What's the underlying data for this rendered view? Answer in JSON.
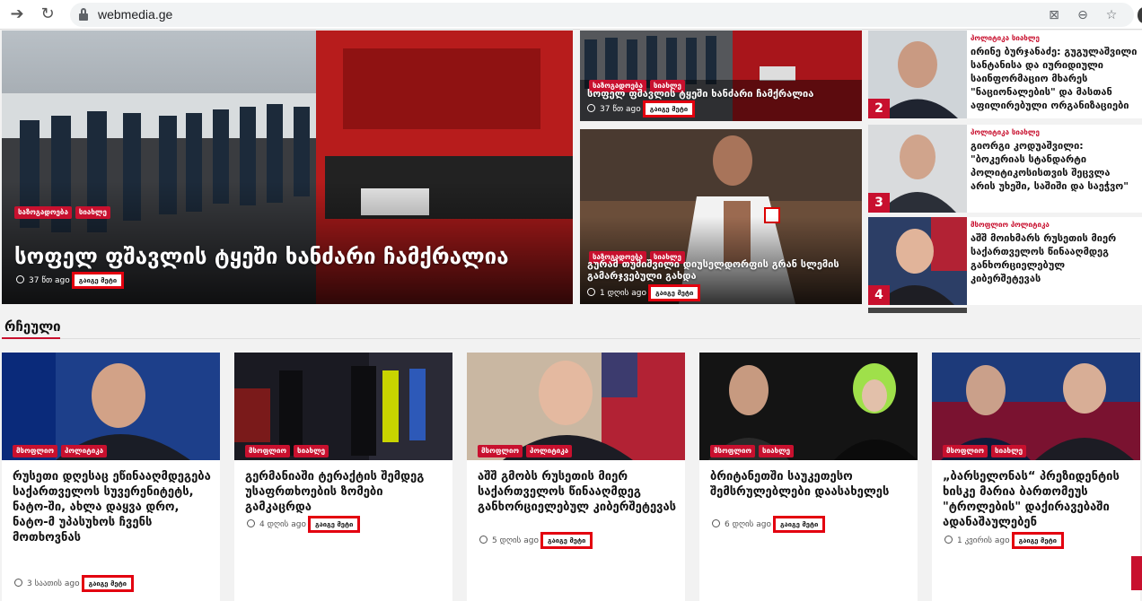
{
  "browser": {
    "url": "webmedia.ge"
  },
  "hero": {
    "tags": [
      "საზოგადოება",
      "სიახლე"
    ],
    "title": "სოფელ ფშავლის ტყეში ხანძარი ჩამქრალია",
    "time": "37 წთ ago",
    "read_more": "გაიგე მეტი"
  },
  "mid": [
    {
      "tags": [
        "საზოგადოება",
        "სიახლე"
      ],
      "title": "სოფელ ფშავლის ტყეში ხანძარი ჩამქრალია",
      "time": "37 წთ ago",
      "read_more": "გაიგე მეტი"
    },
    {
      "tags": [
        "საზოგადოება",
        "სიახლე"
      ],
      "title": "გურამ თუშიშვილი დიუსელდორფის გრან სლემის გამარჯვებული გახდა",
      "time": "1 დღის ago",
      "read_more": "გაიგე მეტი"
    }
  ],
  "side": [
    {
      "num": "2",
      "cat": "პოლიტიკა სიახლე",
      "title": "ირინე ბურჯანაძე: გუგულაშვილი სანტანისა და იურიდიული საინფორმაციო მხარეს \"ნაციონალების\" და მასთან აფილირებული ორგანიზაციები"
    },
    {
      "num": "3",
      "cat": "პოლიტიკა სიახლე",
      "title": "გიორგი კოდუაშვილი: \"ბოკერიას სტანდარტი პოლიტიკოსისთვის შეცვლა არის უხეში, საშიში და საეჭვო\""
    },
    {
      "num": "4",
      "cat": "მსოფლიო პოლიტიკა",
      "title": "აშშ მოიხმარს რუსეთის მიერ საქართველოს წინააღმდეგ განხორციელებულ კიბერშეტევას"
    }
  ],
  "section": {
    "title": "რჩეული"
  },
  "cards": [
    {
      "tags": [
        "მსოფლიო",
        "პოლიტიკა"
      ],
      "title": "რუსეთი დღესაც ეწინააღმდეგება საქართველოს სუვერენიტეტს, ნატო-ში, ახლა დაყვა დრო, ნატო-მ უპასუხოს ჩვენს მოთხოვნას",
      "time": "3 საათის ago",
      "read_more": "გაიგე მეტი"
    },
    {
      "tags": [
        "მსოფლიო",
        "სიახლე"
      ],
      "title": "გერმანიაში ტერაქტის შემდეგ უსაფრთხოების ზომები გამკაცრდა",
      "time": "4 დღის ago",
      "read_more": "გაიგე მეტი"
    },
    {
      "tags": [
        "მსოფლიო",
        "პოლიტიკა"
      ],
      "title": "აშშ გმობს რუსეთის მიერ საქართველოს წინააღმდეგ განხორციელებულ კიბერშეტევას",
      "time": "5 დღის ago",
      "read_more": "გაიგე მეტი"
    },
    {
      "tags": [
        "მსოფლიო",
        "სიახლე"
      ],
      "title": "ბრიტანეთში საუკეთესო შემსრულებლები დაასახელეს",
      "time": "6 დღის ago",
      "read_more": "გაიგე მეტი"
    },
    {
      "tags": [
        "მსოფლიო",
        "სიახლე"
      ],
      "title": "„ბარსელონას“ პრეზიდენტის ხისკე მარია ბართომეუს \"ტროლების\" დაქირავებაში ადანაშაულებენ",
      "time": "1 კვირის ago",
      "read_more": "გაიგე მეტი"
    }
  ]
}
